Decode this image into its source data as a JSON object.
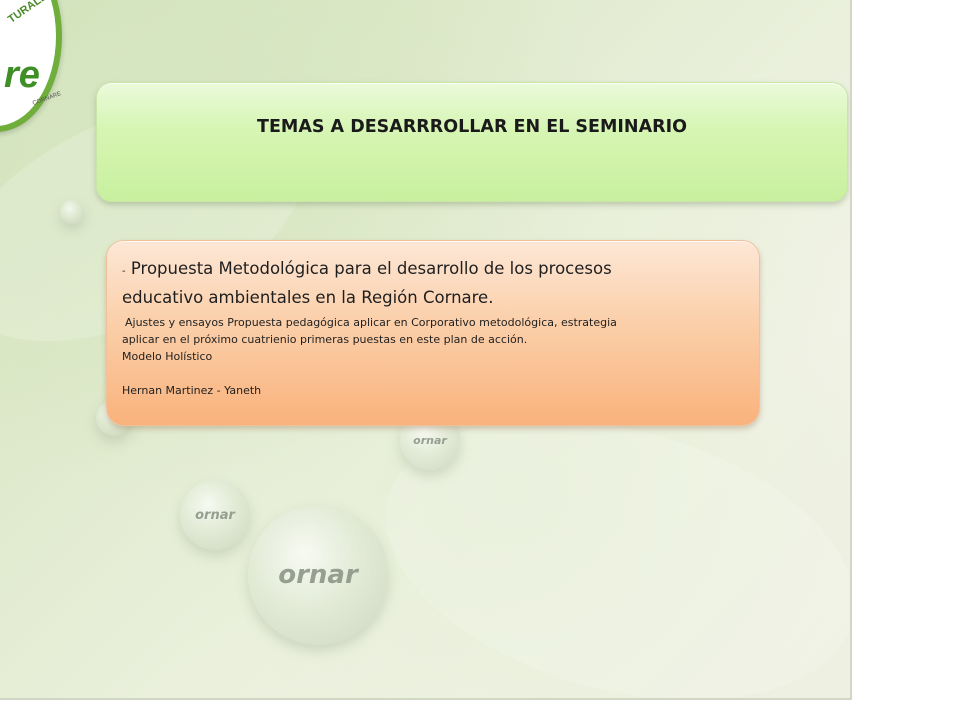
{
  "logo": {
    "arc_text": "TURALEZA",
    "main_text": "re",
    "small_text": "CORNARE"
  },
  "drops": [
    "ornar",
    "ornar",
    "ornar"
  ],
  "title_box": {
    "text": "TEMAS A DESARRROLLAR EN EL SEMINARIO"
  },
  "content_box": {
    "dash": "-",
    "main_line_1": "Propuesta Metodológica para el desarrollo de los procesos",
    "main_line_2": "educativo ambientales en la Región Cornare.",
    "detail_line_1": "Ajustes y ensayos Propuesta pedagógica aplicar en Corporativo  metodológica, estrategia",
    "detail_line_2": "aplicar en el próximo cuatrienio primeras puestas en este plan de acción.",
    "model_line": "Modelo Holístico",
    "authors_line": "Hernan Martinez - Yaneth"
  },
  "colors": {
    "title_green": "#c8f09e",
    "content_orange": "#f9b27c",
    "logo_green": "#6fae3b"
  }
}
